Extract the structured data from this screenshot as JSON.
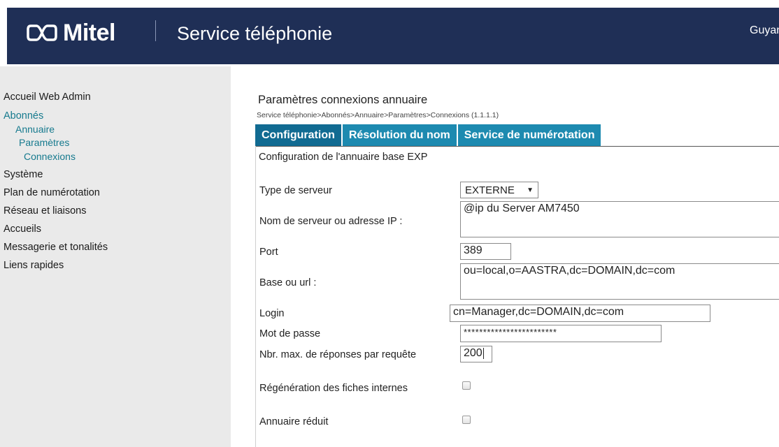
{
  "header": {
    "brand": "Mitel",
    "service_title": "Service téléphonie",
    "user": "Guyan",
    "colors": {
      "background": "#1f2f56",
      "text": "#ffffff"
    }
  },
  "sidebar": {
    "items": [
      {
        "label": "Accueil Web Admin"
      },
      {
        "label": "Abonnés"
      },
      {
        "label": "Annuaire"
      },
      {
        "label": "Paramètres"
      },
      {
        "label": "Connexions"
      },
      {
        "label": "Système"
      },
      {
        "label": "Plan de numérotation"
      },
      {
        "label": "Réseau et liaisons"
      },
      {
        "label": "Accueils"
      },
      {
        "label": "Messagerie et tonalités"
      },
      {
        "label": "Liens rapides"
      }
    ],
    "colors": {
      "active_path": "#167a8e",
      "background": "#eaeaea"
    }
  },
  "main": {
    "title": "Paramètres connexions annuaire",
    "breadcrumb": "Service téléphonie>Abonnés>Annuaire>Paramètres>Connexions (1.1.1.1)",
    "tabs": [
      {
        "label": "Configuration",
        "active": true
      },
      {
        "label": "Résolution du nom",
        "active": false
      },
      {
        "label": "Service de numérotation",
        "active": false
      }
    ],
    "section_title": "Configuration de l'annuaire base EXP",
    "fields": {
      "server_type": {
        "label": "Type de serveur",
        "value": "EXTERNE",
        "arrow": "▼"
      },
      "server_name": {
        "label": "Nom de serveur ou adresse IP :",
        "value": "@ip du Server AM7450"
      },
      "port": {
        "label": "Port",
        "value": "389"
      },
      "base_url": {
        "label": "Base ou url :",
        "value": "ou=local,o=AASTRA,dc=DOMAIN,dc=com"
      },
      "login": {
        "label": "Login",
        "value": "cn=Manager,dc=DOMAIN,dc=com"
      },
      "password": {
        "label": "Mot de passe",
        "value": "************************"
      },
      "max_responses": {
        "label": "Nbr. max. de réponses par requête",
        "value": "200"
      },
      "regen": {
        "label": "Régénération des fiches internes",
        "checked": false
      },
      "reduced": {
        "label": "Annuaire réduit",
        "checked": false
      }
    },
    "colors": {
      "tab": "#1d8ab0",
      "tab_active": "#116b92"
    }
  }
}
